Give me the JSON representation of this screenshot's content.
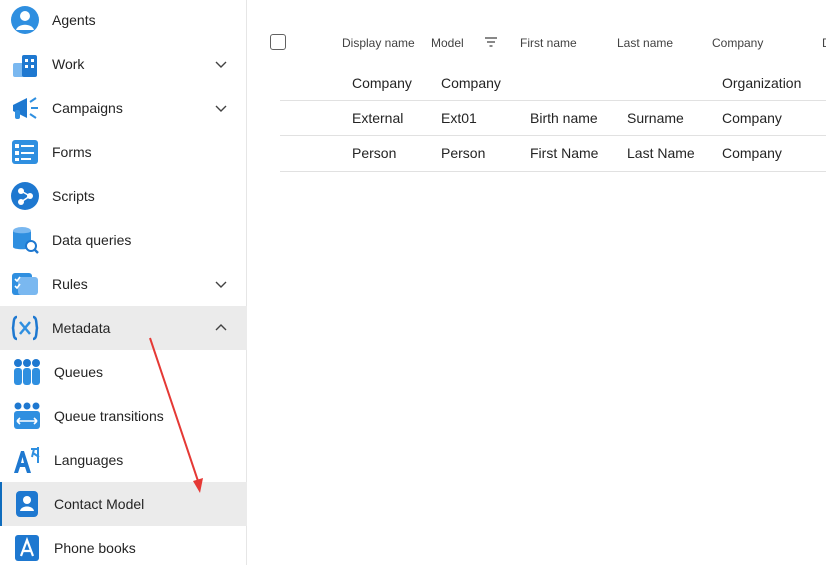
{
  "sidebar": {
    "items": [
      {
        "label": "Agents",
        "icon": "agent-icon",
        "chevron": ""
      },
      {
        "label": "Work",
        "icon": "work-icon",
        "chevron": "down"
      },
      {
        "label": "Campaigns",
        "icon": "megaphone-icon",
        "chevron": "down"
      },
      {
        "label": "Forms",
        "icon": "form-icon",
        "chevron": ""
      },
      {
        "label": "Scripts",
        "icon": "script-icon",
        "chevron": ""
      },
      {
        "label": "Data queries",
        "icon": "database-search-icon",
        "chevron": ""
      },
      {
        "label": "Rules",
        "icon": "rules-icon",
        "chevron": "down"
      },
      {
        "label": "Metadata",
        "icon": "variable-icon",
        "chevron": "up",
        "state": "expanded"
      }
    ],
    "sub_items": [
      {
        "label": "Queues",
        "icon": "queues-icon"
      },
      {
        "label": "Queue transitions",
        "icon": "queue-transitions-icon"
      },
      {
        "label": "Languages",
        "icon": "languages-icon"
      },
      {
        "label": "Contact Model",
        "icon": "contact-card-icon",
        "state": "selected"
      },
      {
        "label": "Phone books",
        "icon": "phone-book-icon"
      }
    ]
  },
  "table": {
    "headers": [
      "Display name",
      "Model",
      "First name",
      "Last name",
      "Company",
      "D"
    ],
    "rows": [
      [
        "Company",
        "Company",
        "",
        "",
        "Organization"
      ],
      [
        "External",
        "Ext01",
        "Birth name",
        "Surname",
        "Company"
      ],
      [
        "Person",
        "Person",
        "First Name",
        "Last Name",
        "Company"
      ]
    ]
  },
  "colors": {
    "accent": "#0f6cbd",
    "selected_bg": "#ebebeb",
    "annotation_arrow": "#e53935"
  }
}
